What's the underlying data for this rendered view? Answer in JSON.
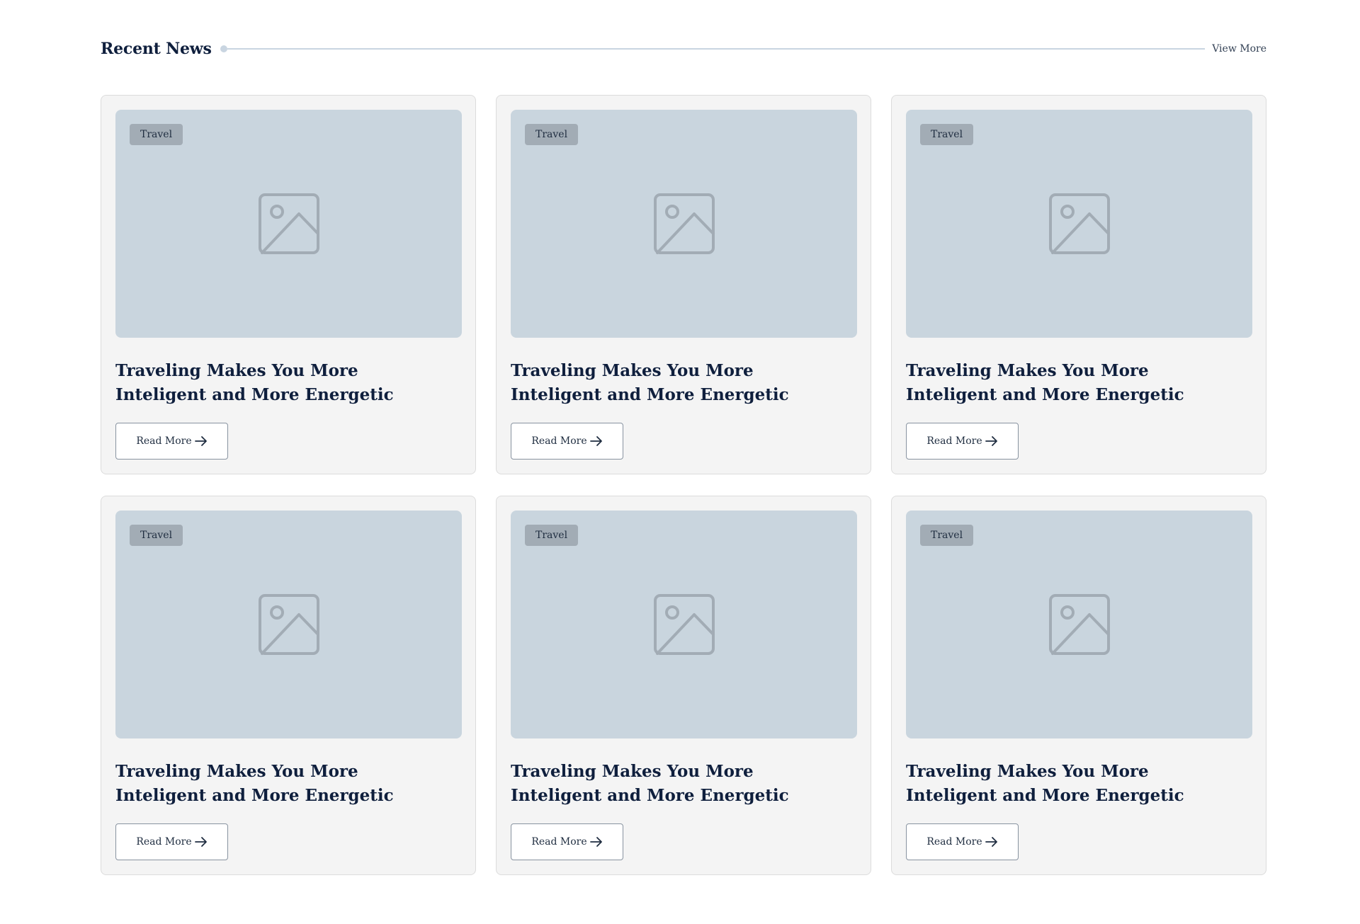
{
  "header": {
    "title": "Recent News",
    "view_more": "View More"
  },
  "cards": [
    {
      "badge": "Travel",
      "title": "Traveling Makes You More Inteligent and More Energetic",
      "button": "Read More",
      "image_icon": "image-placeholder-icon"
    },
    {
      "badge": "Travel",
      "title": "Traveling Makes You More Inteligent and More Energetic",
      "button": "Read More",
      "image_icon": "image-placeholder-icon"
    },
    {
      "badge": "Travel",
      "title": "Traveling Makes You More Inteligent and More Energetic",
      "button": "Read More",
      "image_icon": "image-placeholder-icon"
    },
    {
      "badge": "Travel",
      "title": "Traveling Makes You More Inteligent and More Energetic",
      "button": "Read More",
      "image_icon": "image-placeholder-icon"
    },
    {
      "badge": "Travel",
      "title": "Traveling Makes You More Inteligent and More Energetic",
      "button": "Read More",
      "image_icon": "image-placeholder-icon"
    },
    {
      "badge": "Travel",
      "title": "Traveling Makes You More Inteligent and More Energetic",
      "button": "Read More",
      "image_icon": "image-placeholder-icon"
    }
  ],
  "colors": {
    "heading": "#0f1f3d",
    "card_bg": "#f4f4f4",
    "thumb_bg": "#c9d5de",
    "badge_bg": "#a2acb5",
    "divider": "#c9d5e1"
  }
}
